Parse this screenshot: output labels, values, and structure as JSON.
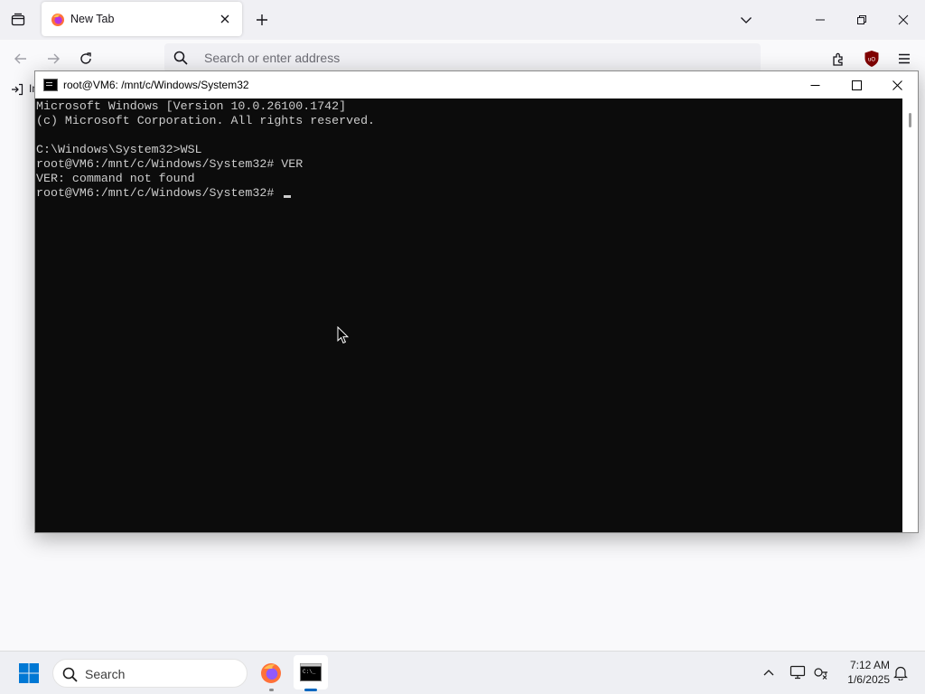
{
  "browser": {
    "tab": {
      "title": "New Tab",
      "favicon": "firefox-icon"
    },
    "urlbar": {
      "placeholder": "Search or enter address"
    },
    "bookmarks": {
      "import_label": "Im"
    },
    "accent": "#e63e00"
  },
  "terminal": {
    "title": "root@VM6: /mnt/c/Windows/System32",
    "lines": [
      "Microsoft Windows [Version 10.0.26100.1742]",
      "(c) Microsoft Corporation. All rights reserved.",
      "",
      "C:\\Windows\\System32>WSL",
      "root@VM6:/mnt/c/Windows/System32# VER",
      "VER: command not found",
      "root@VM6:/mnt/c/Windows/System32# "
    ],
    "background": "#0c0c0c",
    "foreground": "#cccccc"
  },
  "taskbar": {
    "search_label": "Search",
    "clock": {
      "time": "7:12 AM",
      "date": "1/6/2025"
    },
    "apps": [
      "firefox-icon",
      "command-prompt-icon"
    ],
    "active_indicator": "#0067c0"
  }
}
